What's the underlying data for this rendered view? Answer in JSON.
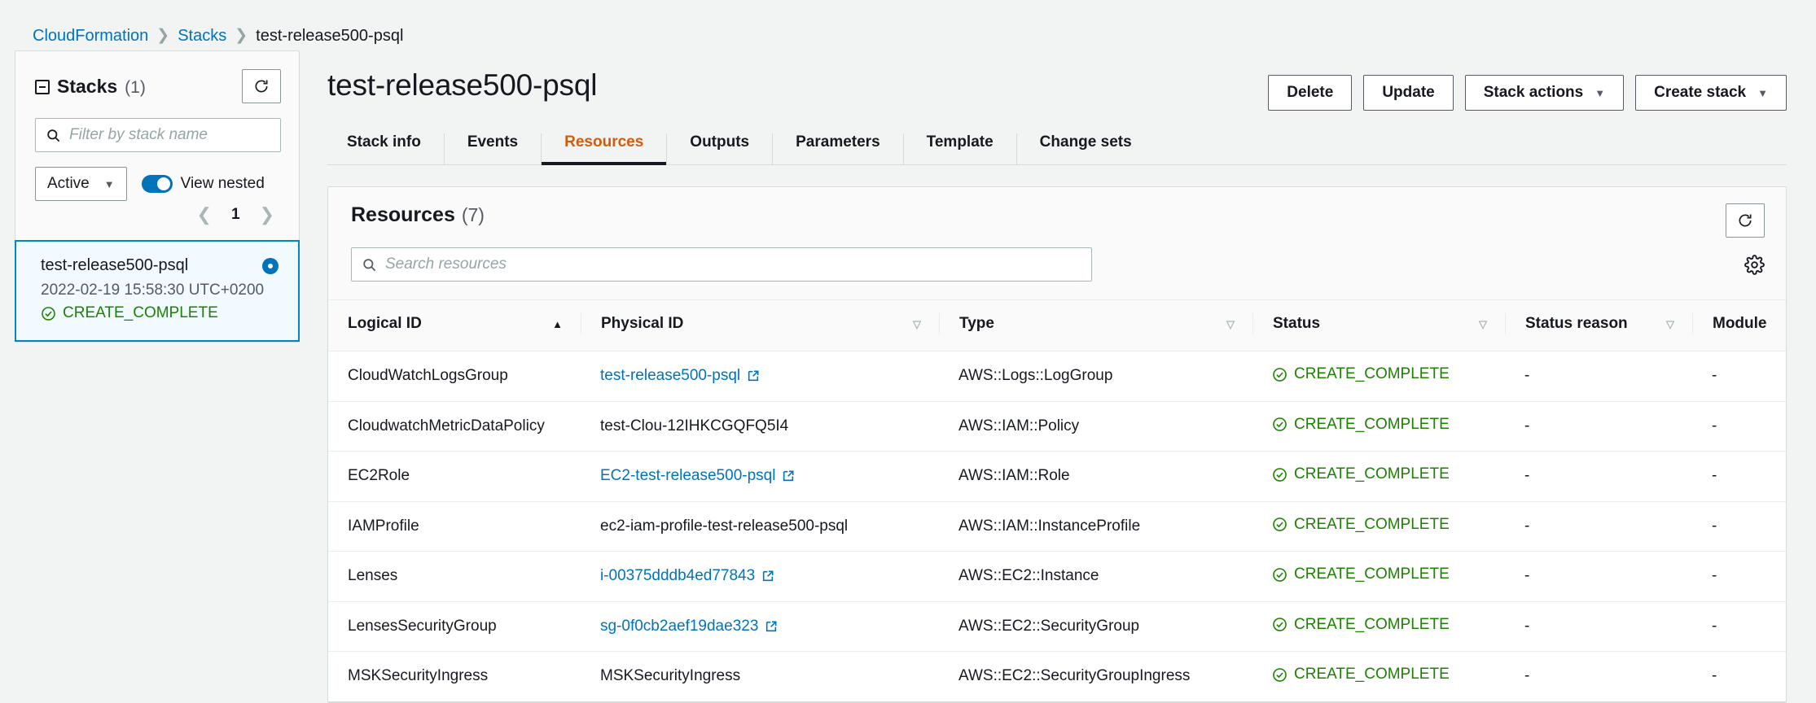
{
  "breadcrumb": {
    "items": [
      {
        "label": "CloudFormation",
        "link": true
      },
      {
        "label": "Stacks",
        "link": true
      },
      {
        "label": "test-release500-psql",
        "link": false
      }
    ],
    "separator": "❯"
  },
  "sidebar": {
    "title_label": "Stacks",
    "title_count": "(1)",
    "refresh_icon": "refresh-icon",
    "filter": {
      "placeholder": "Filter by stack name",
      "value": "",
      "icon": "search-icon"
    },
    "status_filter": {
      "value": "Active",
      "caret": "▼"
    },
    "view_nested": {
      "label": "View nested",
      "enabled": true
    },
    "pager": {
      "prev": "❮",
      "page": "1",
      "next": "❯"
    },
    "stack_card": {
      "name": "test-release500-psql",
      "date": "2022-02-19 15:58:30 UTC+0200",
      "status": "CREATE_COMPLETE",
      "status_icon": "check-circle-icon",
      "selected": true
    }
  },
  "header": {
    "title": "test-release500-psql",
    "actions": [
      {
        "label": "Delete",
        "caret": ""
      },
      {
        "label": "Update",
        "caret": ""
      },
      {
        "label": "Stack actions",
        "caret": "▼"
      },
      {
        "label": "Create stack",
        "caret": "▼"
      }
    ]
  },
  "tabs": [
    {
      "label": "Stack info",
      "active": false
    },
    {
      "label": "Events",
      "active": false
    },
    {
      "label": "Resources",
      "active": true
    },
    {
      "label": "Outputs",
      "active": false
    },
    {
      "label": "Parameters",
      "active": false
    },
    {
      "label": "Template",
      "active": false
    },
    {
      "label": "Change sets",
      "active": false
    }
  ],
  "resources_panel": {
    "title_label": "Resources",
    "title_count": "(7)",
    "refresh_icon": "refresh-icon",
    "settings_icon": "gear-icon",
    "search": {
      "placeholder": "Search resources",
      "value": "",
      "icon": "search-icon"
    },
    "columns": [
      {
        "label": "Logical ID",
        "sort": "asc",
        "glyph": "▲"
      },
      {
        "label": "Physical ID",
        "sort": "none",
        "glyph": "▽"
      },
      {
        "label": "Type",
        "sort": "none",
        "glyph": "▽"
      },
      {
        "label": "Status",
        "sort": "none",
        "glyph": "▽"
      },
      {
        "label": "Status reason",
        "sort": "none",
        "glyph": "▽"
      },
      {
        "label": "Module",
        "sort": "none",
        "glyph": "▽"
      }
    ],
    "rows": [
      {
        "logical_id": "CloudWatchLogsGroup",
        "physical_id": "test-release500-psql",
        "physical_id_link": true,
        "type": "AWS::Logs::LogGroup",
        "status": "CREATE_COMPLETE",
        "status_reason": "-",
        "module": "-"
      },
      {
        "logical_id": "CloudwatchMetricDataPolicy",
        "physical_id": "test-Clou-12IHKCGQFQ5I4",
        "physical_id_link": false,
        "type": "AWS::IAM::Policy",
        "status": "CREATE_COMPLETE",
        "status_reason": "-",
        "module": "-"
      },
      {
        "logical_id": "EC2Role",
        "physical_id": "EC2-test-release500-psql",
        "physical_id_link": true,
        "type": "AWS::IAM::Role",
        "status": "CREATE_COMPLETE",
        "status_reason": "-",
        "module": "-"
      },
      {
        "logical_id": "IAMProfile",
        "physical_id": "ec2-iam-profile-test-release500-psql",
        "physical_id_link": false,
        "type": "AWS::IAM::InstanceProfile",
        "status": "CREATE_COMPLETE",
        "status_reason": "-",
        "module": "-"
      },
      {
        "logical_id": "Lenses",
        "physical_id": "i-00375dddb4ed77843",
        "physical_id_link": true,
        "type": "AWS::EC2::Instance",
        "status": "CREATE_COMPLETE",
        "status_reason": "-",
        "module": "-"
      },
      {
        "logical_id": "LensesSecurityGroup",
        "physical_id": "sg-0f0cb2aef19dae323",
        "physical_id_link": true,
        "type": "AWS::EC2::SecurityGroup",
        "status": "CREATE_COMPLETE",
        "status_reason": "-",
        "module": "-"
      },
      {
        "logical_id": "MSKSecurityIngress",
        "physical_id": "MSKSecurityIngress",
        "physical_id_link": false,
        "type": "AWS::EC2::SecurityGroupIngress",
        "status": "CREATE_COMPLETE",
        "status_reason": "-",
        "module": "-"
      }
    ]
  },
  "colors": {
    "link": "#0073bb",
    "accent_tab": "#d45b07",
    "success": "#1d8102",
    "selected_border": "#0086c4",
    "selected_bg": "#f1faff"
  }
}
